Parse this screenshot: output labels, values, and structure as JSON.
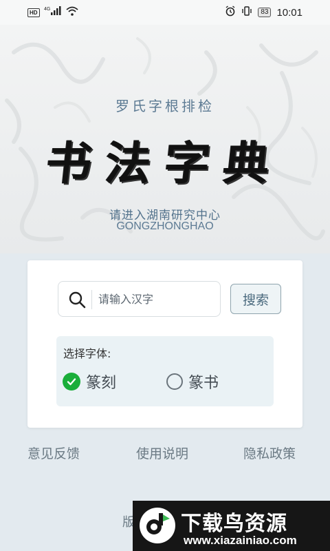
{
  "status_bar": {
    "hd_label": "HD",
    "network_label": "4G",
    "battery": "83",
    "time": "10:01"
  },
  "banner": {
    "subtitle": "罗氏字根排检",
    "title": "书法字典",
    "cta": "请进入湖南研究中心",
    "cta_sub": "GONGZHONGHAO"
  },
  "search": {
    "placeholder": "请输入汉字",
    "value": "",
    "button_label": "搜索"
  },
  "font_select": {
    "label": "选择字体:",
    "options": [
      {
        "label": "篆刻",
        "selected": true
      },
      {
        "label": "篆书",
        "selected": false
      }
    ]
  },
  "footer": {
    "links": [
      "意见反馈",
      "使用说明",
      "隐私政策"
    ],
    "version_prefix": "版"
  },
  "watermark": {
    "title": "下载鸟资源",
    "url": "www.xiazainiao.com"
  },
  "colors": {
    "accent_green": "#1aae3a",
    "brand_blue_gray": "#5c7a93",
    "page_bg": "#e3eaef"
  },
  "icons": [
    "wifi-icon",
    "signal-icon",
    "alarm-icon",
    "vibrate-icon",
    "search-icon",
    "check-icon",
    "logo-icon"
  ]
}
